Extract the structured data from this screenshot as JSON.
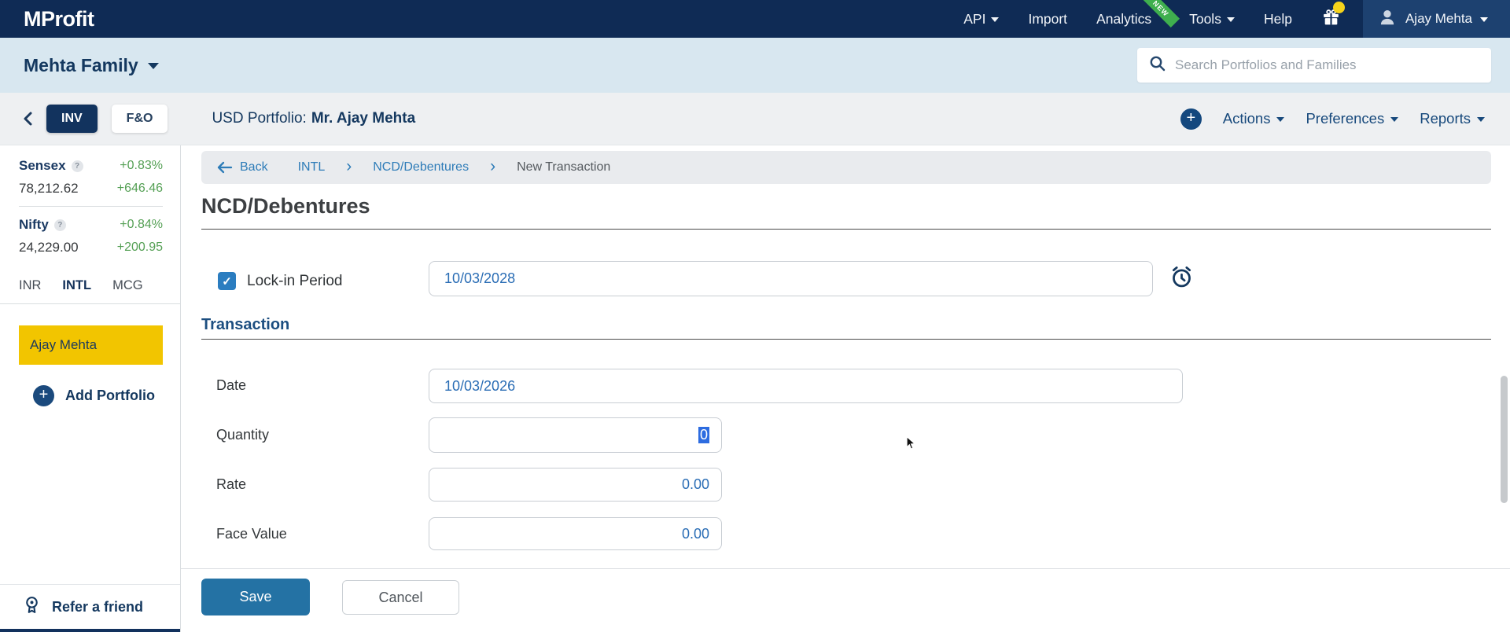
{
  "colors": {
    "navbar_navy": "#0f2b55",
    "accent_navy": "#14385f",
    "link_blue": "#2e7cb8",
    "value_blue": "#2a6db5",
    "highlight_yellow": "#f2c500",
    "positive_green": "#55a055",
    "save_blue": "#2472a4",
    "new_badge_green": "#3faf4e",
    "selection_blue": "#2d6ce0"
  },
  "navbar": {
    "logo": "MProfit",
    "api_label": "API",
    "import_label": "Import",
    "analytics_label": "Analytics",
    "analytics_badge": "NEW",
    "tools_label": "Tools",
    "help_label": "Help",
    "user_name": "Ajay Mehta"
  },
  "family_bar": {
    "family_name": "Mehta Family",
    "search_placeholder": "Search Portfolios and Families"
  },
  "portfolio_bar": {
    "inv_tab": "INV",
    "fo_tab": "F&O",
    "portfolio_label": "USD Portfolio:",
    "portfolio_name": "Mr. Ajay Mehta",
    "actions_label": "Actions",
    "preferences_label": "Preferences",
    "reports_label": "Reports"
  },
  "sidebar": {
    "indices": [
      {
        "name": "Sensex",
        "value": "78,212.62",
        "change_pct": "+0.83%",
        "change_abs": "+646.46"
      },
      {
        "name": "Nifty",
        "value": "24,229.00",
        "change_pct": "+0.84%",
        "change_abs": "+200.95"
      }
    ],
    "currency_tabs": [
      {
        "label": "INR"
      },
      {
        "label": "INTL"
      },
      {
        "label": "MCG"
      }
    ],
    "selected_portfolio": "Ajay Mehta",
    "add_portfolio_label": "Add Portfolio",
    "refer_label": "Refer a friend"
  },
  "main": {
    "breadcrumb": {
      "back_label": "Back",
      "level1": "INTL",
      "level2": "NCD/Debentures",
      "level3": "New Transaction"
    },
    "title": "NCD/Debentures",
    "lockin_label": "Lock-in Period",
    "lockin_value": "10/03/2028",
    "section_title": "Transaction",
    "fields": [
      {
        "label": "Date",
        "value": "10/03/2026"
      },
      {
        "label": "Quantity",
        "value": "0"
      },
      {
        "label": "Rate",
        "value": "0.00"
      },
      {
        "label": "Face Value",
        "value": "0.00"
      }
    ],
    "save_label": "Save",
    "cancel_label": "Cancel"
  }
}
